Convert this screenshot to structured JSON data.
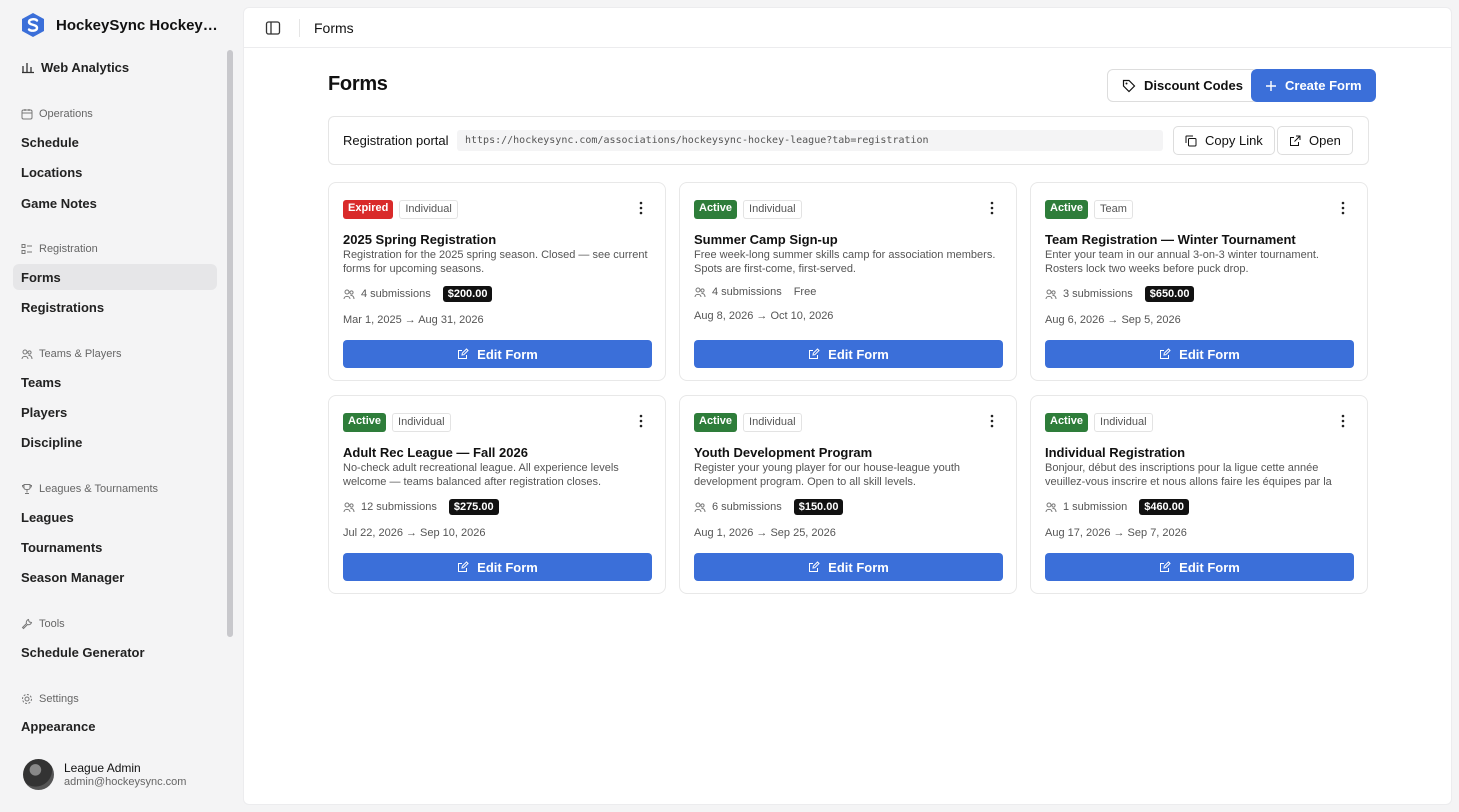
{
  "app": {
    "name": "HockeySync Hockey Le..."
  },
  "sidebar": {
    "top_item": {
      "label": "Web Analytics",
      "icon": "chart-icon"
    },
    "sections": [
      {
        "label": "Operations",
        "icon": "calendar-icon",
        "items": [
          "Schedule",
          "Locations",
          "Game Notes"
        ]
      },
      {
        "label": "Registration",
        "icon": "list-icon",
        "items": [
          "Forms",
          "Registrations"
        ]
      },
      {
        "label": "Teams & Players",
        "icon": "users-icon",
        "items": [
          "Teams",
          "Players",
          "Discipline"
        ]
      },
      {
        "label": "Leagues & Tournaments",
        "icon": "trophy-icon",
        "items": [
          "Leagues",
          "Tournaments",
          "Season Manager"
        ]
      },
      {
        "label": "Tools",
        "icon": "wrench-icon",
        "items": [
          "Schedule Generator"
        ]
      },
      {
        "label": "Settings",
        "icon": "gear-icon",
        "items": [
          "Appearance"
        ]
      }
    ],
    "active_item": "Forms",
    "user": {
      "name": "League Admin",
      "email": "admin@hockeysync.com"
    }
  },
  "header": {
    "title": "Forms"
  },
  "page": {
    "title": "Forms",
    "discount_label": "Discount Codes",
    "create_label": "Create Form"
  },
  "portal": {
    "label": "Registration portal",
    "url": "https://hockeysync.com/associations/hockeysync-hockey-league?tab=registration",
    "copy_label": "Copy Link",
    "open_label": "Open"
  },
  "forms": [
    {
      "status": "Expired",
      "type": "Individual",
      "title": "2025 Spring Registration",
      "description": "Registration for the 2025 spring season. Closed — see current forms for upcoming seasons.",
      "submissions": "4 submissions",
      "price": "$200.00",
      "dates": "Mar 1, 2025 → Aug 31, 2026",
      "edit_label": "Edit Form"
    },
    {
      "status": "Active",
      "type": "Individual",
      "title": "Summer Camp Sign-up",
      "description": "Free week-long summer skills camp for association members. Spots are first-come, first-served.",
      "submissions": "4 submissions",
      "price": "Free",
      "dates": "Aug 8, 2026 → Oct 10, 2026",
      "edit_label": "Edit Form"
    },
    {
      "status": "Active",
      "type": "Team",
      "title": "Team Registration — Winter Tournament",
      "description": "Enter your team in our annual 3-on-3 winter tournament. Rosters lock two weeks before puck drop.",
      "submissions": "3 submissions",
      "price": "$650.00",
      "dates": "Aug 6, 2026 → Sep 5, 2026",
      "edit_label": "Edit Form"
    },
    {
      "status": "Active",
      "type": "Individual",
      "title": "Adult Rec League — Fall 2026",
      "description": "No-check adult recreational league. All experience levels welcome — teams balanced after registration closes.",
      "submissions": "12 submissions",
      "price": "$275.00",
      "dates": "Jul 22, 2026 → Sep 10, 2026",
      "edit_label": "Edit Form"
    },
    {
      "status": "Active",
      "type": "Individual",
      "title": "Youth Development Program",
      "description": "Register your young player for our house-league youth development program. Open to all skill levels.",
      "submissions": "6 submissions",
      "price": "$150.00",
      "dates": "Aug 1, 2026 → Sep 25, 2026",
      "edit_label": "Edit Form"
    },
    {
      "status": "Active",
      "type": "Individual",
      "title": "Individual Registration",
      "description": "Bonjour, début des inscriptions pour la ligue cette année veuillez-vous inscrire et nous allons faire les équipes par la suit...",
      "submissions": "1 submission",
      "price": "$460.00",
      "dates": "Aug 17, 2026 → Sep 7, 2026",
      "edit_label": "Edit Form"
    }
  ],
  "colors": {
    "primary": "#3b6fd9",
    "active": "#2e7d3a",
    "expired": "#d92a2a"
  }
}
